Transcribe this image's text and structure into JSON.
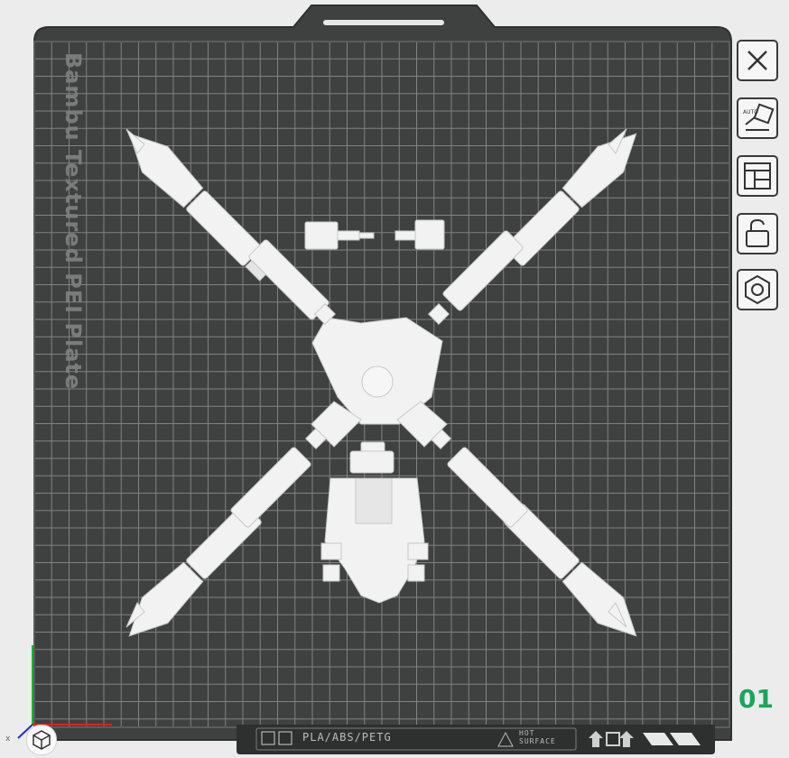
{
  "plate": {
    "label": "Bambu Textured PEI Plate",
    "number": "01",
    "filament_label": "PLA/ABS/PETG",
    "hot_surface_label": "HOT\nSURFACE"
  },
  "axis": {
    "x_label": "x"
  },
  "toolbar": {
    "items": [
      {
        "name": "close-plate-button",
        "icon": "close-icon"
      },
      {
        "name": "auto-orient-button",
        "icon": "auto-orient-icon"
      },
      {
        "name": "arrange-button",
        "icon": "layout-icon"
      },
      {
        "name": "lock-plate-button",
        "icon": "unlock-icon"
      },
      {
        "name": "plate-settings-button",
        "icon": "hexagon-icon"
      }
    ]
  },
  "colors": {
    "plate": "#3f4040",
    "grid": "#8d8e8e",
    "model": "#f2f2f2",
    "model_shadow": "#cfcfcf",
    "accent_green": "#1aa55a",
    "axis_x": "#e02020",
    "axis_y": "#20b040",
    "axis_z": "#2030c0"
  }
}
